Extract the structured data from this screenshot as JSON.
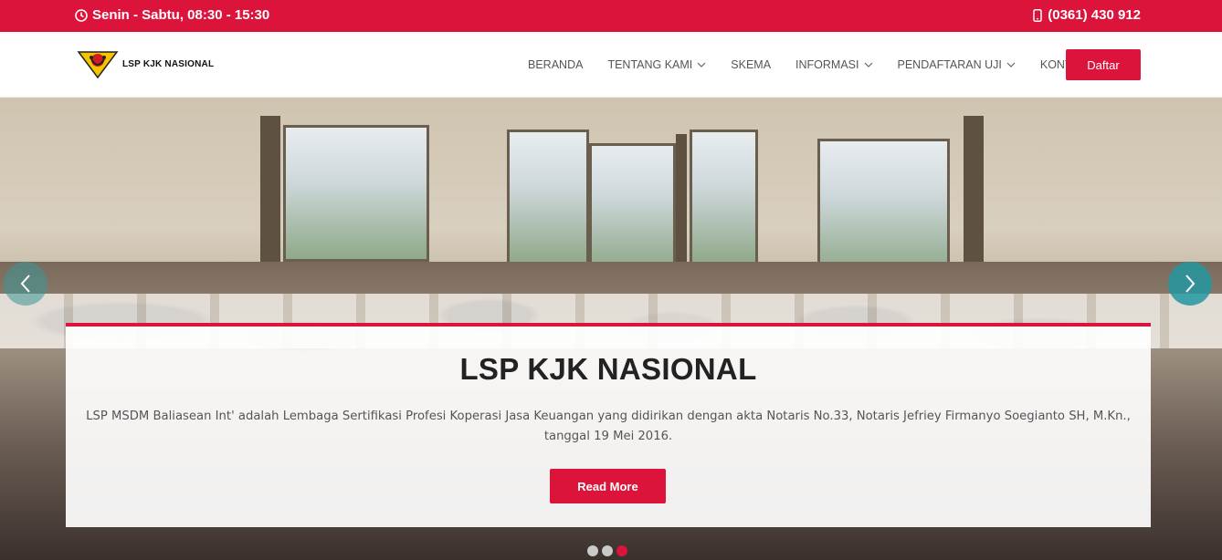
{
  "topbar": {
    "hours": "Senin - Sabtu, 08:30 - 15:30",
    "phone": "(0361) 430 912",
    "background_color": "#dc143c"
  },
  "header": {
    "logo_text": "LSP KJK NASIONAL",
    "nav": [
      {
        "label": "BERANDA",
        "has_dropdown": false
      },
      {
        "label": "TENTANG KAMI",
        "has_dropdown": true
      },
      {
        "label": "SKEMA",
        "has_dropdown": false
      },
      {
        "label": "INFORMASI",
        "has_dropdown": true
      },
      {
        "label": "PENDAFTARAN UJI",
        "has_dropdown": true
      },
      {
        "label": "KONTAK",
        "has_dropdown": false
      }
    ],
    "cta_label": "Daftar"
  },
  "hero": {
    "title": "LSP KJK NASIONAL",
    "description": "LSP MSDM Baliasean Int' adalah Lembaga Sertifikasi Profesi Koperasi Jasa Keuangan yang didirikan dengan akta Notaris No.33, Notaris Jefriey Firmanyo Soegianto SH, M.Kn., tanggal 19 Mei 2016.",
    "button_label": "Read More",
    "slides": 3,
    "active_slide": 3
  },
  "colors": {
    "accent": "#dc143c",
    "arrow": "#239aa0"
  },
  "icons": {
    "clock": "clock-icon",
    "phone": "mobile-phone-icon",
    "chevron": "chevron-down-icon",
    "prev": "chevron-left-icon",
    "next": "chevron-right-icon"
  }
}
